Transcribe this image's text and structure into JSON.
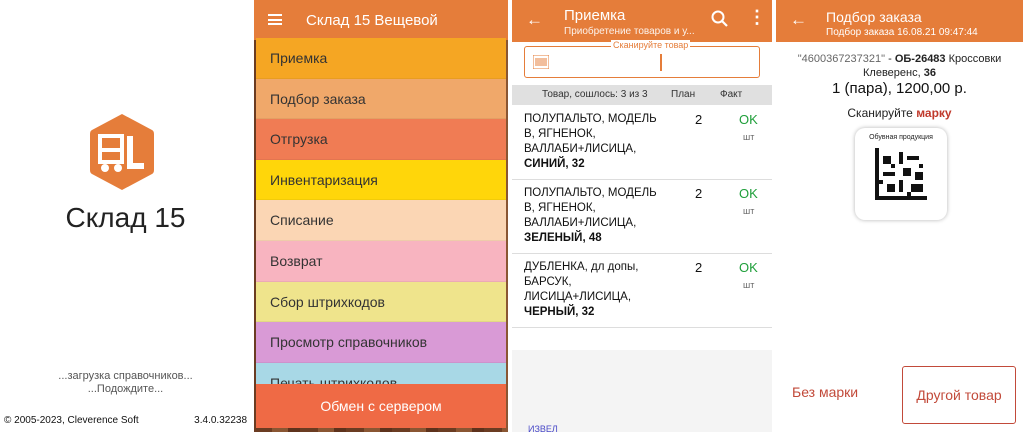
{
  "splash": {
    "app_title": "Склад 15",
    "loading_line1": "...загрузка справочников...",
    "loading_line2": "...Подождите...",
    "copyright": "© 2005-2023, Cleverence Soft",
    "version": "3.4.0.32238",
    "logo_color": "#e57d3a"
  },
  "menu_screen": {
    "title": "Склад 15 Вещевой",
    "items": [
      {
        "label": "Приемка",
        "color": "#f5a623"
      },
      {
        "label": "Подбор заказа",
        "color": "#f0a86a"
      },
      {
        "label": "Отгрузка",
        "color": "#f07c54"
      },
      {
        "label": "Инвентаризация",
        "color": "#ffd60a"
      },
      {
        "label": "Списание",
        "color": "#fbd6b4"
      },
      {
        "label": "Возврат",
        "color": "#f8b4c0"
      },
      {
        "label": "Сбор штрихкодов",
        "color": "#efe48c"
      },
      {
        "label": "Просмотр справочников",
        "color": "#d99ad6"
      },
      {
        "label": "Печать штрихкодов",
        "color": "#a8d8e6"
      }
    ],
    "sync_button": "Обмен с сервером"
  },
  "receiving": {
    "title": "Приемка",
    "subtitle": "Приобретение товаров и у...",
    "scan_label": "Сканируйте товар",
    "col_item": "Товар, сошлось: 3 из 3",
    "col_plan": "План",
    "col_fact": "Факт",
    "rows": [
      {
        "l1": "ПОЛУПАЛЬТО, МОДЕЛЬ",
        "l2": "В, ЯГНЕНОК,",
        "l3": "ВАЛЛАБИ+ЛИСИЦА,",
        "l4": "СИНИЙ, 32",
        "plan": "2",
        "fact": "OK",
        "unit": "шт"
      },
      {
        "l1": "ПОЛУПАЛЬТО, МОДЕЛЬ",
        "l2": "В, ЯГНЕНОК,",
        "l3": "ВАЛЛАБИ+ЛИСИЦА,",
        "l4": "ЗЕЛЕНЫЙ, 48",
        "plan": "2",
        "fact": "OK",
        "unit": "шт"
      },
      {
        "l1": "ДУБЛЕНКА, дл допы,",
        "l2": "БАРСУК,",
        "l3": "ЛИСИЦА+ЛИСИЦА,",
        "l4": "ЧЕРНЫЙ, 32",
        "plan": "2",
        "fact": "OK",
        "unit": "шт"
      }
    ],
    "bottom_cut_text": "ИЗВЕЛ"
  },
  "picking": {
    "title": "Подбор заказа",
    "subtitle": "Подбор заказа 16.08.21 09:47:44",
    "barcode": "\"4600367237321\"",
    "article": "ОБ-26483",
    "name_a": "Кроссовки",
    "name_b": "Клеверенс,",
    "size": "36",
    "qty_price": "1 (пара), 1200,00 р.",
    "scan_prefix": "Сканируйте",
    "scan_mark": "марку",
    "card_caption": "Обувная продукция",
    "btn_no_mark": "Без марки",
    "btn_other": "Другой товар"
  }
}
